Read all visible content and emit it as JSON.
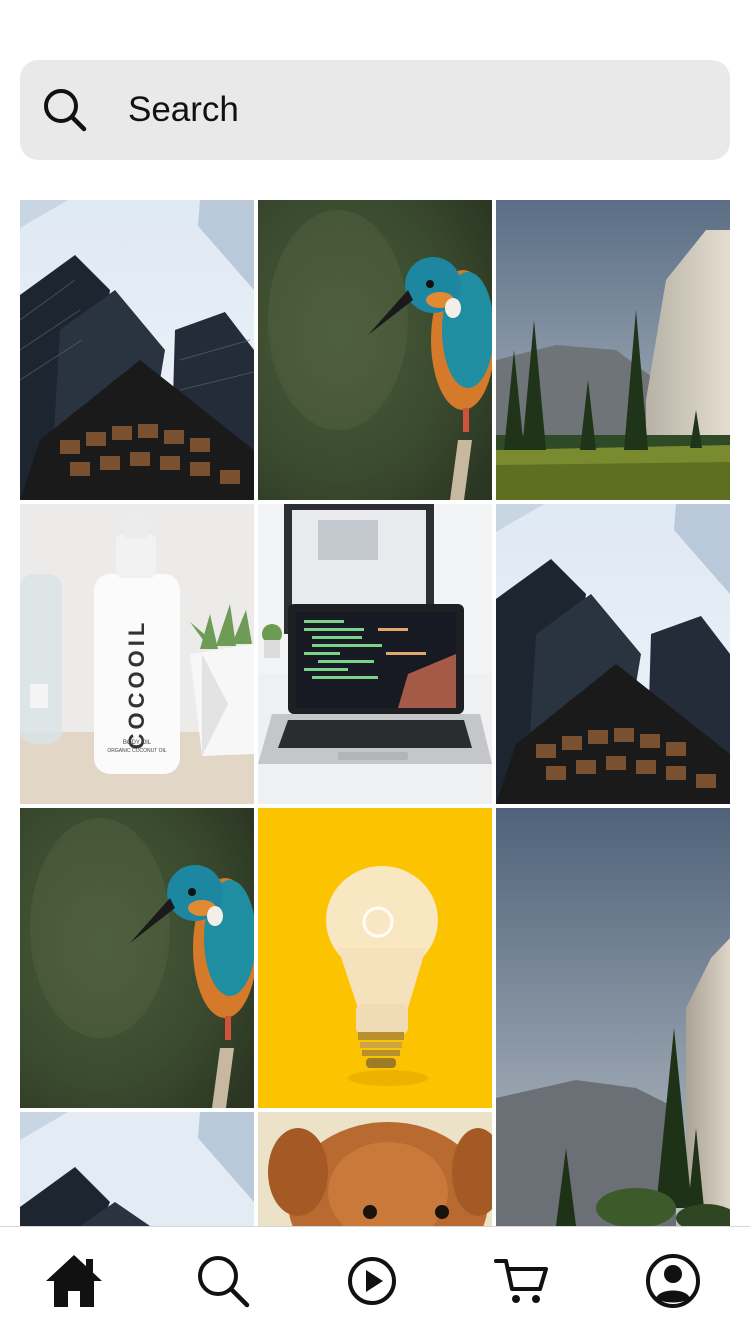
{
  "search": {
    "placeholder": "Search",
    "icon": "search-icon"
  },
  "grid": {
    "tiles": [
      {
        "subject": "skyscrapers"
      },
      {
        "subject": "kingfisher"
      },
      {
        "subject": "mountain-valley"
      },
      {
        "subject": "body-oil-bottle",
        "bottle_text": "COCOOIL",
        "bottle_subtext": "BODY OIL",
        "bottle_subtext2": "ORGANIC COCONUT OIL"
      },
      {
        "subject": "laptop-desk"
      },
      {
        "subject": "skyscrapers"
      },
      {
        "subject": "kingfisher"
      },
      {
        "subject": "light-bulb"
      },
      {
        "subject": "mountain-valley"
      },
      {
        "subject": "skyscrapers"
      },
      {
        "subject": "puppy"
      }
    ]
  },
  "tab_bar": {
    "items": [
      {
        "icon": "home-icon",
        "active": true
      },
      {
        "icon": "search-icon",
        "active": false
      },
      {
        "icon": "play-icon",
        "active": false
      },
      {
        "icon": "cart-icon",
        "active": false
      },
      {
        "icon": "profile-icon",
        "active": false
      }
    ]
  },
  "colors": {
    "search_bg": "#e9e9e9",
    "icon": "#111111",
    "bulb_bg": "#fcc400"
  }
}
